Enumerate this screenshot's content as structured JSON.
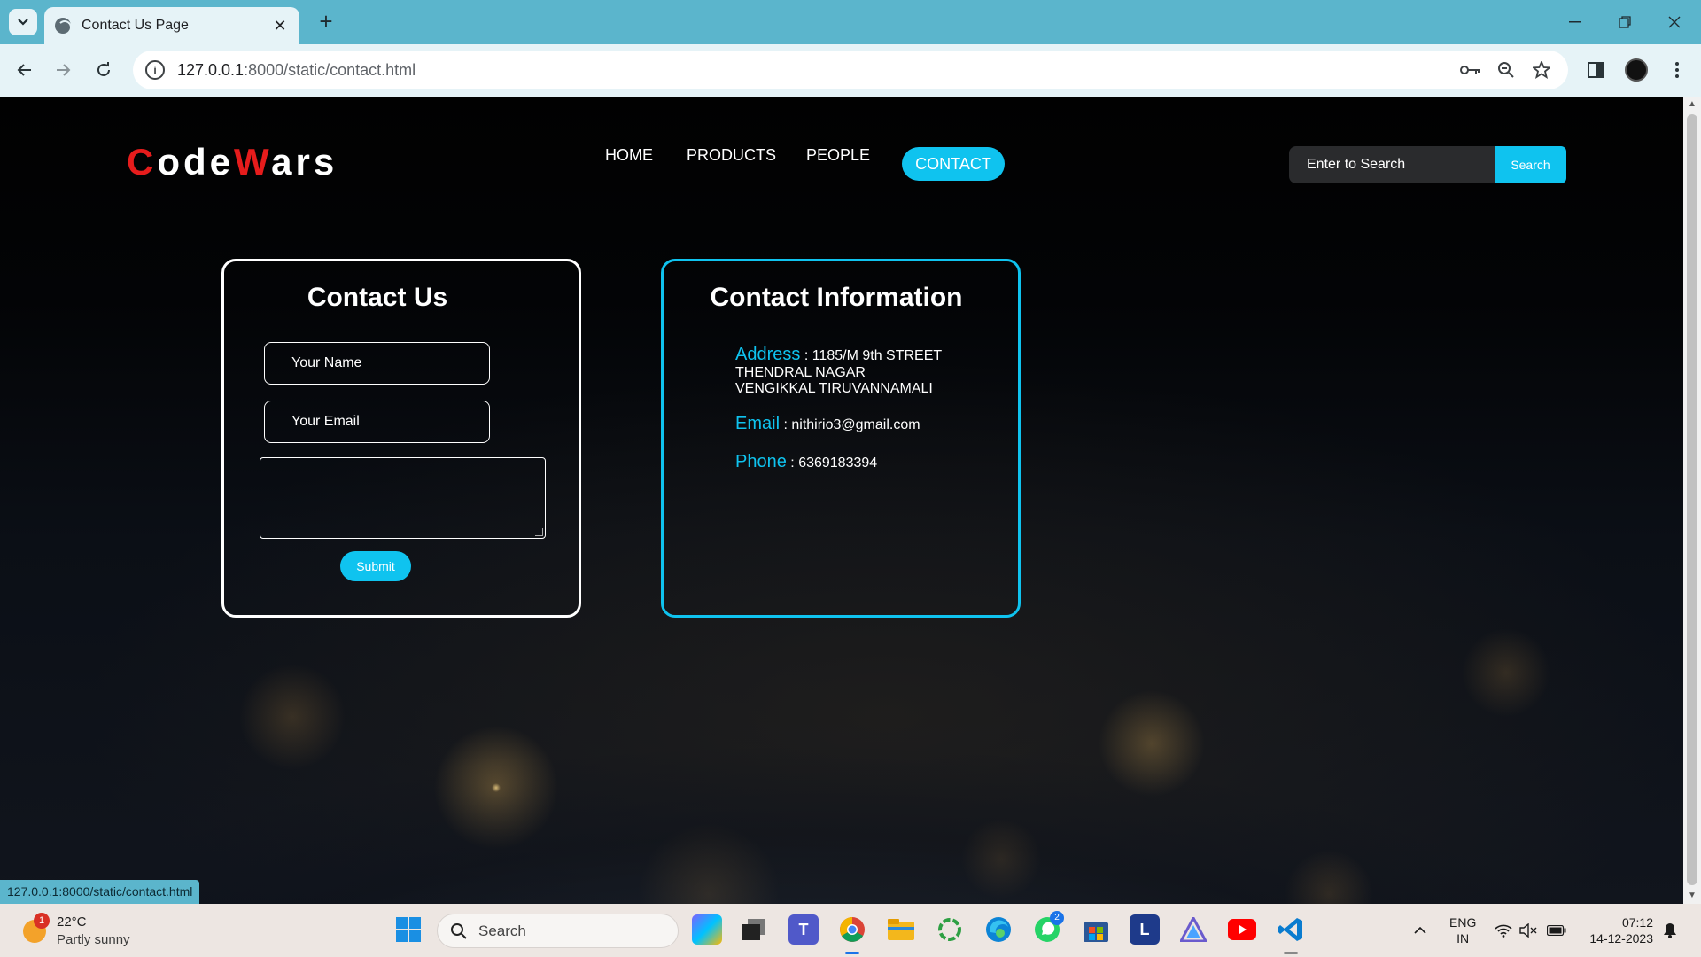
{
  "browser": {
    "tab_title": "Contact Us Page",
    "tab_close": "✕",
    "new_tab": "+",
    "url_host": "127.0.0.1",
    "url_path": ":8000/static/contact.html"
  },
  "site": {
    "logo_first_letter": "C",
    "logo_part1": "ode",
    "logo_second_letter": "W",
    "logo_part2": "ars",
    "nav": {
      "home": "HOME",
      "products": "PRODUCTS",
      "people": "PEOPLE",
      "contact": "CONTACT"
    },
    "search_placeholder": "Enter to Search",
    "search_button": "Search"
  },
  "contact_form": {
    "title": "Contact Us",
    "name_placeholder": "Your Name",
    "email_placeholder": "Your Email",
    "submit_label": "Submit"
  },
  "contact_info": {
    "title": "Contact Information",
    "address_label": "Address",
    "address_line1": "1185/M 9th STREET",
    "address_line2": "THENDRAL NAGAR",
    "address_line3": "VENGIKKAL TIRUVANNAMALI",
    "email_label": "Email",
    "email_value": "nithirio3@gmail.com",
    "phone_label": "Phone",
    "phone_value": "6369183394",
    "separator": " : "
  },
  "status_url": "127.0.0.1:8000/static/contact.html",
  "taskbar": {
    "weather_temp": "22°C",
    "weather_desc": "Partly sunny",
    "weather_badge": "1",
    "search_label": "Search",
    "whatsapp_badge": "2",
    "lang_line1": "ENG",
    "lang_line2": "IN",
    "time": "07:12",
    "date": "14-12-2023"
  },
  "colors": {
    "accent": "#0fc3ef",
    "logo_red": "#e61c1c",
    "chrome": "#5bb5cc"
  }
}
